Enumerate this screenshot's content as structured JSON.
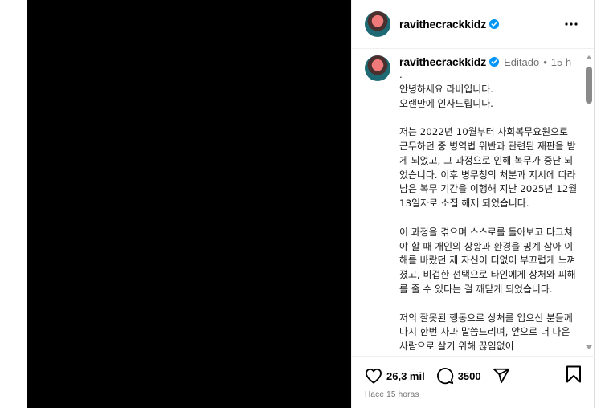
{
  "post": {
    "username": "ravithecrackkidz",
    "verified": true,
    "more_icon": "more-horizontal-icon"
  },
  "caption": {
    "username": "ravithecrackkidz",
    "edited": "Editado",
    "separator": "•",
    "time": "15 h",
    "text": ".\n안녕하세요 라비입니다.\n오랜만에 인사드립니다.\n\n저는 2022년 10월부터 사회복무요원으로 근무하던 중 병역법 위반과 관련된 재판을 받게 되었고, 그 과정으로 인해 복무가 중단 되었습니다. 이후 병무청의 처분과 지시에 따라 남은 복무 기간을 이행해 지난 2025년 12월 13일자로 소집 해제 되었습니다.\n\n이 과정을 겪으며 스스로를 돌아보고 다그쳐야 할 때 개인의 상황과 환경을 핑계 삼아 이해를 바랐던 제 자신이 더없이 부끄럽게 느껴졌고, 비겁한 선택으로 타인에게 상처와 피해를 줄 수 있다는 걸 깨닫게 되었습니다.\n\n저의 잘못된 행동으로 상처를 입으신 분들께 다시 한번 사과 말씀드리며, 앞으로 더 나은 사람으로 살기 위해 끊임없이"
  },
  "actions": {
    "likes": "26,3 mil",
    "comments": "3500",
    "icons": [
      "heart-icon",
      "comment-icon",
      "share-icon",
      "bookmark-icon"
    ]
  },
  "footer": {
    "ago": "Hace 15 horas"
  },
  "colors": {
    "media_background": "#000000",
    "verified_blue": "#0095f6",
    "secondary_text": "#737373"
  }
}
